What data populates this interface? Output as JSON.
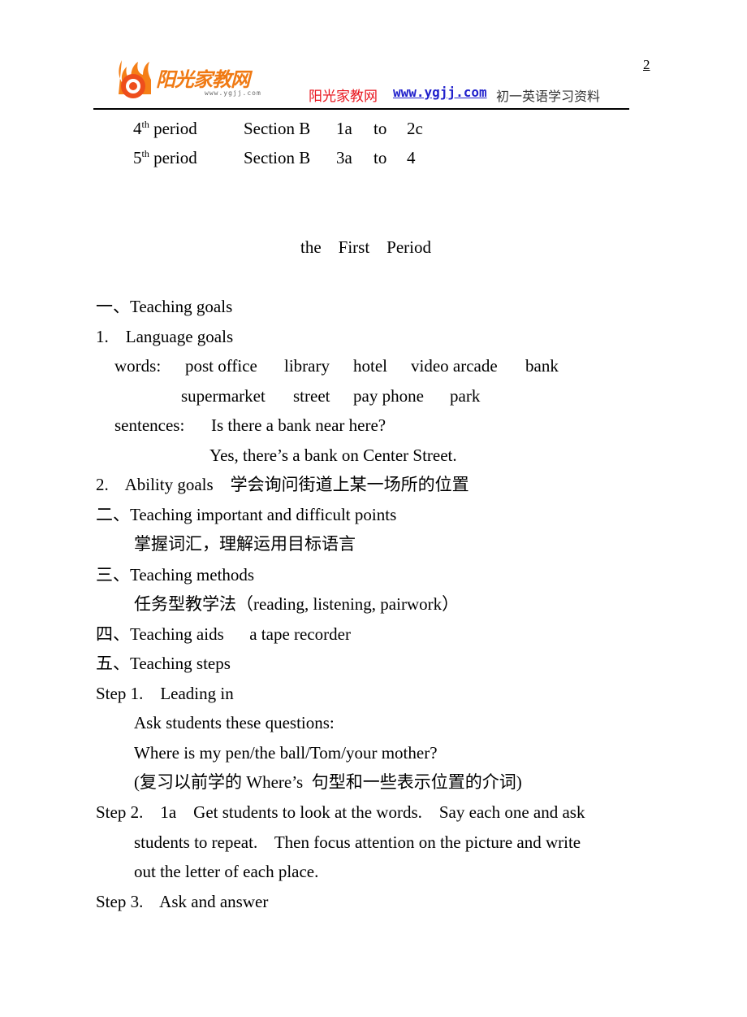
{
  "header": {
    "logo_text": "阳光家教网",
    "logo_url": "www.ygjj.com",
    "site_name": "阳光家教网",
    "site_url": "www.ygjj.com",
    "description": "初一英语学习资料",
    "page_number": "2"
  },
  "periods": [
    {
      "num": "4",
      "suffix": "th",
      "label": "period",
      "section": "Section B",
      "from": "1a",
      "to_word": "to",
      "to": "2c"
    },
    {
      "num": "5",
      "suffix": "th",
      "label": "period",
      "section": "Section B",
      "from": "3a",
      "to_word": "to",
      "to": "4"
    }
  ],
  "title": "the    First    Period",
  "lines": {
    "goals_heading": "一、Teaching goals",
    "language_goals": "1.    Language goals",
    "words_label": "words:",
    "words_row1": [
      "post office",
      "library",
      "hotel",
      "video arcade",
      "bank"
    ],
    "words_row2": [
      "supermarket",
      "street",
      "pay phone",
      "park"
    ],
    "sentences_label": "sentences:",
    "sentence1": "Is there a bank near here?",
    "sentence2": "Yes, there’s a bank on Center Street.",
    "ability_goals": "2.    Ability goals    学会询问街道上某一场所的位置",
    "important_heading": "二、Teaching important and difficult points",
    "important_text": "掌握词汇，理解运用目标语言",
    "methods_heading": "三、Teaching methods",
    "methods_text": "任务型教学法（reading, listening, pairwork）",
    "aids": "四、Teaching aids      a tape recorder",
    "steps_heading": "五、Teaching steps",
    "step1": "Step 1.    Leading in",
    "step1_a": "Ask students these questions:",
    "step1_b": "Where is my pen/the ball/Tom/your mother?",
    "step1_c": "(复习以前学的 Where’s  句型和一些表示位置的介词)",
    "step2_a": "Step 2.    1a    Get students to look at the words.    Say each one and ask",
    "step2_b": "students to repeat.    Then focus attention on the picture and write",
    "step2_c": "out the letter of each place.",
    "step3": "Step 3.    Ask and answer"
  }
}
